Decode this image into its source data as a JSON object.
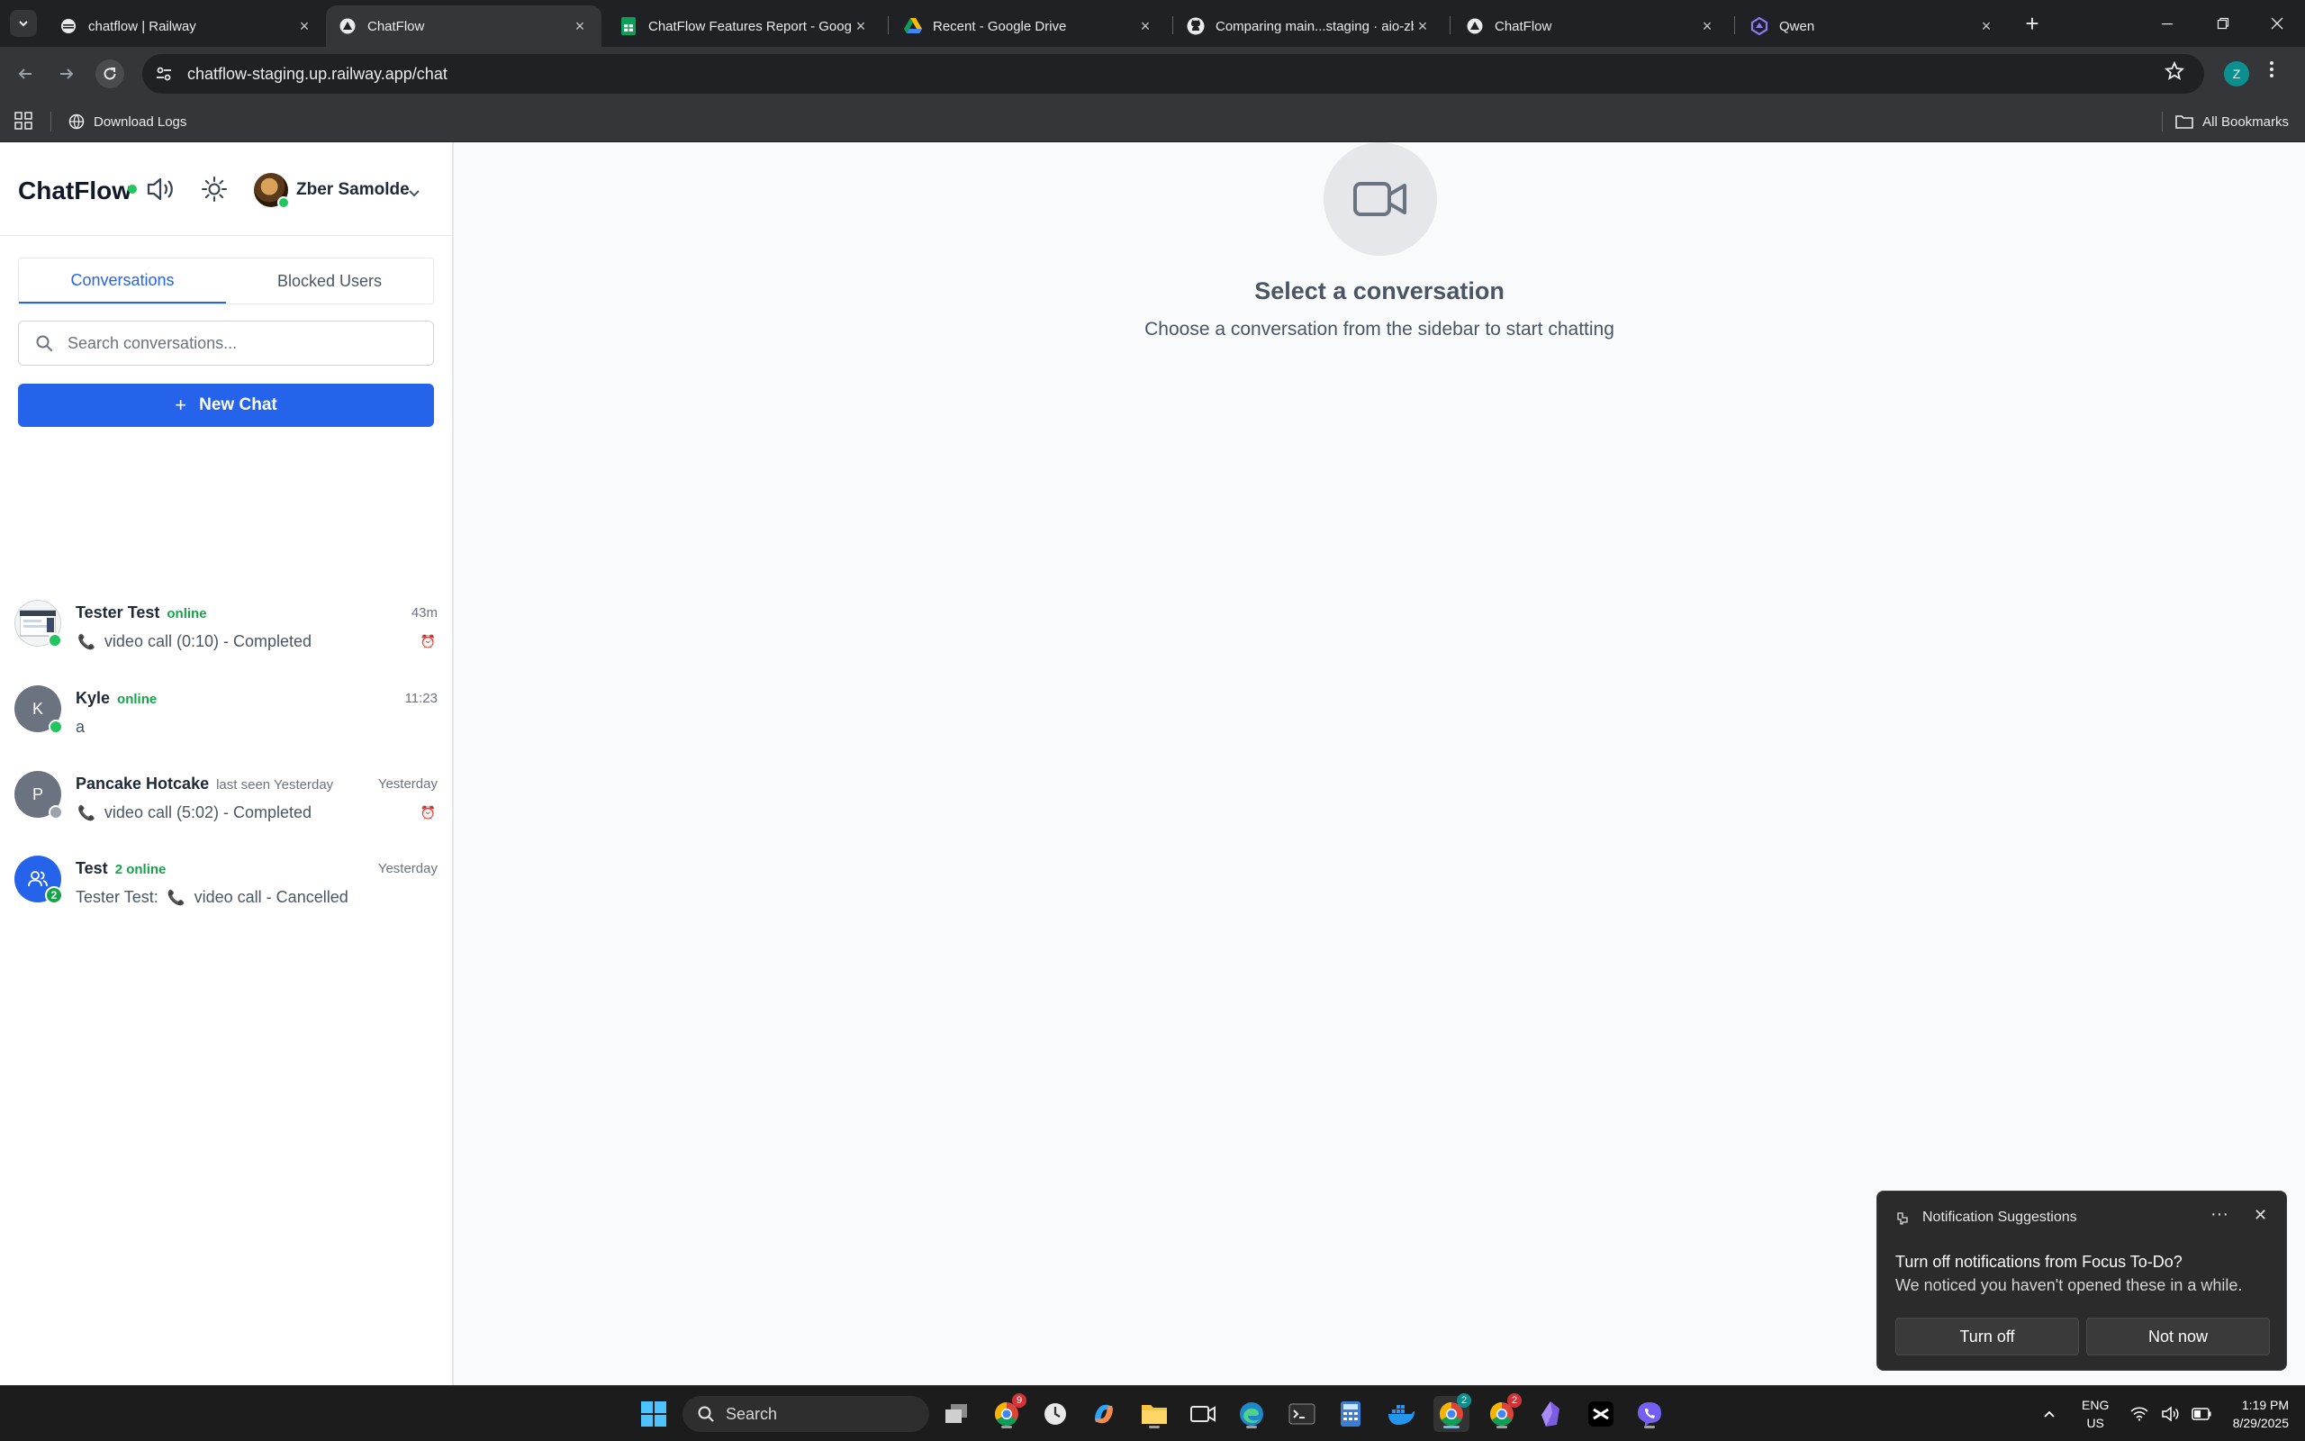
{
  "browser": {
    "tabs": [
      {
        "label": "chatflow | Railway",
        "icon": "railway-icon"
      },
      {
        "label": "ChatFlow",
        "icon": "vercel-icon",
        "active": true
      },
      {
        "label": "ChatFlow Features Report - Googl",
        "icon": "google-sheets-icon"
      },
      {
        "label": "Recent - Google Drive",
        "icon": "google-drive-icon"
      },
      {
        "label": "Comparing main...staging · aio-zbe",
        "icon": "github-icon"
      },
      {
        "label": "ChatFlow",
        "icon": "vercel-icon"
      },
      {
        "label": "Qwen",
        "icon": "qwen-icon"
      }
    ],
    "url": "chatflow-staging.up.railway.app/chat",
    "profile_initial": "Z",
    "bookmarks": [
      {
        "label": "Download Logs"
      }
    ],
    "all_bookmarks_label": "All Bookmarks"
  },
  "app": {
    "brand": "ChatFlow",
    "user": {
      "name": "Zber Samolde"
    },
    "tabs": {
      "conversations": "Conversations",
      "blocked": "Blocked Users",
      "active": "conversations"
    },
    "search": {
      "placeholder": "Search conversations..."
    },
    "new_chat_label": "New Chat",
    "conversations": [
      {
        "name": "Tester Test",
        "status": "online",
        "time": "43m",
        "preview": "video call (0:10) - Completed",
        "has_call_icon": true,
        "alarm": true,
        "avatar": "image",
        "presence": "online"
      },
      {
        "name": "Kyle",
        "status": "online",
        "time": "11:23",
        "preview": "a",
        "avatar_initial": "K",
        "presence": "online"
      },
      {
        "name": "Pancake Hotcake",
        "status": "last seen Yesterday",
        "time": "Yesterday",
        "preview": "video call (5:02) - Completed",
        "has_call_icon": true,
        "alarm": true,
        "avatar_initial": "P",
        "presence": "offline"
      },
      {
        "name": "Test",
        "status": "2 online",
        "time": "Yesterday",
        "preview_prefix": "Tester Test:",
        "preview": "video call - Cancelled",
        "has_call_icon": true,
        "avatar": "group",
        "group_count": "2"
      }
    ],
    "empty_state": {
      "title": "Select a conversation",
      "subtitle": "Choose a conversation from the sidebar to start chatting"
    }
  },
  "notification": {
    "title": "Notification Suggestions",
    "heading": "Turn off notifications from Focus To-Do?",
    "body": "We noticed you haven't opened these in a while.",
    "primary": "Turn off",
    "secondary": "Not now"
  },
  "taskbar": {
    "search_label": "Search",
    "lang_line1": "ENG",
    "lang_line2": "US",
    "time": "1:19 PM",
    "date": "8/29/2025",
    "chrome_badge_1": "2",
    "chrome_badge_2": "2",
    "chrome_badge_0": "9"
  },
  "colors": {
    "accent": "#2563eb",
    "online": "#22c55e"
  }
}
